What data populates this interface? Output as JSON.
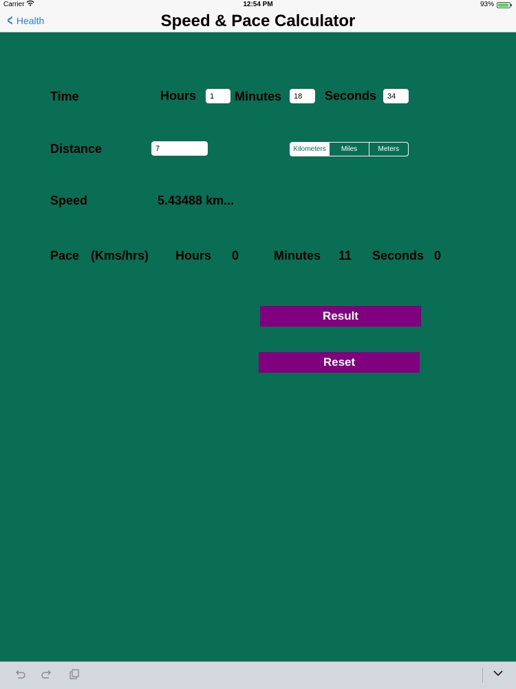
{
  "status_bar": {
    "carrier": "Carrier",
    "time": "12:54 PM",
    "battery": "93%"
  },
  "nav": {
    "back_label": "Health",
    "title": "Speed & Pace Calculator"
  },
  "time_row": {
    "label": "Time",
    "hours_label": "Hours",
    "hours_value": "1",
    "minutes_label": "Minutes",
    "minutes_value": "18",
    "seconds_label": "Seconds",
    "seconds_value": "34"
  },
  "distance_row": {
    "label": "Distance",
    "value": "7",
    "units": [
      "Kilometers",
      "Miles",
      "Meters"
    ],
    "selected_unit": "Kilometers"
  },
  "speed_row": {
    "label": "Speed",
    "value": "5.43488 km..."
  },
  "pace_row": {
    "label": "Pace",
    "unit": "(Kms/hrs)",
    "hours_label": "Hours",
    "hours_value": "0",
    "minutes_label": "Minutes",
    "minutes_value": "11",
    "seconds_label": "Seconds",
    "seconds_value": "0"
  },
  "buttons": {
    "result": "Result",
    "reset": "Reset"
  },
  "colors": {
    "background": "#0a6e54",
    "button": "#800080",
    "link": "#2a7fe6"
  },
  "toolbar": {
    "icons": [
      "undo-icon",
      "redo-icon",
      "paste-icon",
      "chevron-down-icon"
    ]
  }
}
